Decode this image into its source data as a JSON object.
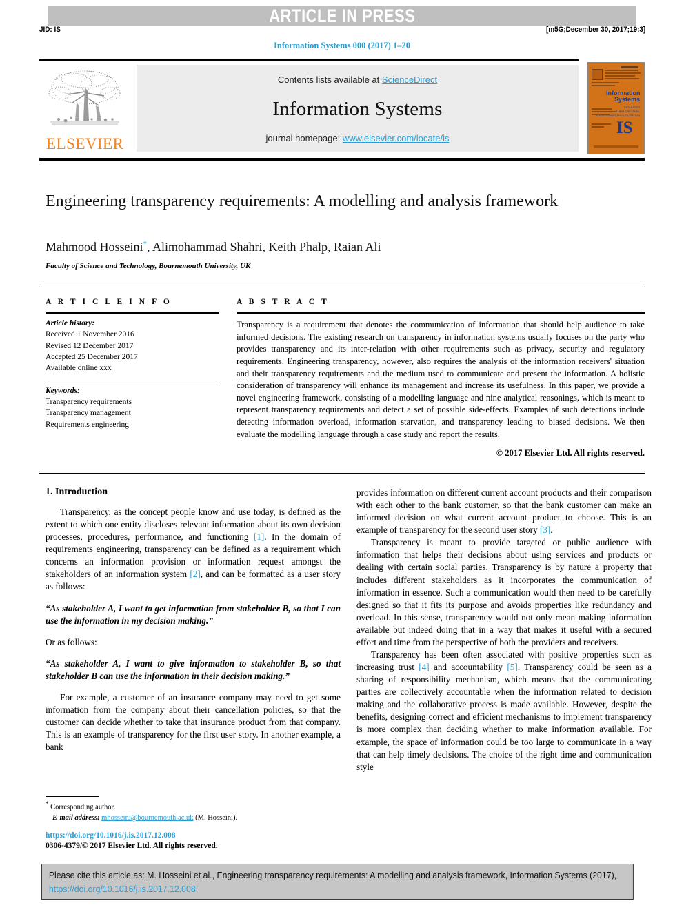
{
  "header": {
    "banner_text": "ARTICLE IN PRESS",
    "jid": "JID: IS",
    "stamp": "[m5G;December 30, 2017;19:3]",
    "journal_ref": "Information Systems 000 (2017) 1–20"
  },
  "masthead": {
    "contents_prefix": "Contents lists available at ",
    "sciencedirect_link": "ScienceDirect",
    "journal_name": "Information Systems",
    "homepage_prefix": "journal homepage: ",
    "homepage_link": "www.elsevier.com/locate/is",
    "publisher_logo_text": "ELSEVIER",
    "cover": {
      "title_line1": "Information",
      "title_line2": "Systems",
      "subtitle": "DATABASES",
      "subtitle2": "THEIR CREATION, MANAGEMENT AND UTILIZATION",
      "logo_text": "IS"
    }
  },
  "article": {
    "title": "Engineering transparency requirements: A modelling and analysis framework",
    "authors": "Mahmood Hosseini, Alimohammad Shahri, Keith Phalp, Raian Ali",
    "corresponding_marker": "*",
    "affiliation": "Faculty of Science and Technology, Bournemouth University, UK"
  },
  "article_info": {
    "heading": "A R T I C L E   I N F O",
    "history_label": "Article history:",
    "history": [
      "Received 1 November 2016",
      "Revised 12 December 2017",
      "Accepted 25 December 2017",
      "Available online xxx"
    ],
    "keywords_label": "Keywords:",
    "keywords": [
      "Transparency requirements",
      "Transparency management",
      "Requirements engineering"
    ]
  },
  "abstract": {
    "heading": "A B S T R A C T",
    "body": "Transparency is a requirement that denotes the communication of information that should help audience to take informed decisions. The existing research on transparency in information systems usually focuses on the party who provides transparency and its inter-relation with other requirements such as privacy, security and regulatory requirements. Engineering transparency, however, also requires the analysis of the information receivers' situation and their transparency requirements and the medium used to communicate and present the information. A holistic consideration of transparency will enhance its management and increase its usefulness. In this paper, we provide a novel engineering framework, consisting of a modelling language and nine analytical reasonings, which is meant to represent transparency requirements and detect a set of possible side-effects. Examples of such detections include detecting information overload, information starvation, and transparency leading to biased decisions. We then evaluate the modelling language through a case study and report the results.",
    "copyright": "© 2017 Elsevier Ltd. All rights reserved."
  },
  "body": {
    "section_heading": "1. Introduction",
    "left": {
      "p1_a": "Transparency, as the concept people know and use today, is defined as the extent to which one entity discloses relevant information about its own decision processes, procedures, performance, and functioning ",
      "p1_ref1": "[1]",
      "p1_b": ". In the domain of requirements engineering, transparency can be defined as a requirement which concerns an information provision or information request amongst the stakeholders of an information system ",
      "p1_ref2": "[2]",
      "p1_c": ", and can be formatted as a user story as follows:",
      "quote1": "“As stakeholder A, I want to get information from stakeholder B, so that I can use the information in my decision making.”",
      "or_line": "Or as follows:",
      "quote2": "“As stakeholder A, I want to give information to stakeholder B, so that stakeholder B can use the information in their decision making.”",
      "p2": "For example, a customer of an insurance company may need to get some information from the company about their cancellation policies, so that the customer can decide whether to take that insurance product from that company. This is an example of transparency for the first user story. In another example, a bank"
    },
    "right": {
      "p1_a": "provides information on different current account products and their comparison with each other to the bank customer, so that the bank customer can make an informed decision on what current account product to choose. This is an example of transparency for the second user story ",
      "p1_ref3": "[3]",
      "p1_b": ".",
      "p2": "Transparency is meant to provide targeted or public audience with information that helps their decisions about using services and products or dealing with certain social parties. Transparency is by nature a property that includes different stakeholders as it incorporates the communication of information in essence. Such a communication would then need to be carefully designed so that it fits its purpose and avoids properties like redundancy and overload. In this sense, transparency would not only mean making information available but indeed doing that in a way that makes it useful with a secured effort and time from the perspective of both the providers and receivers.",
      "p3_a": "Transparency has been often associated with positive properties such as increasing trust ",
      "p3_ref4": "[4]",
      "p3_b": " and accountability ",
      "p3_ref5": "[5]",
      "p3_c": ". Transparency could be seen as a sharing of responsibility mechanism, which means that the communicating parties are collectively accountable when the information related to decision making and the collaborative process is made available. However, despite the benefits, designing correct and efficient mechanisms to implement transparency is more complex than deciding whether to make information available. For example, the space of information could be too large to communicate in a way that can help timely decisions. The choice of the right time and communication style"
    }
  },
  "footnote": {
    "corresponding": "Corresponding author.",
    "email_label": "E-mail address:",
    "email": "mhosseini@bournemouth.ac.uk",
    "email_suffix": "(M. Hosseini).",
    "doi": "https://doi.org/10.1016/j.is.2017.12.008",
    "issn_copyright": "0306-4379/© 2017 Elsevier Ltd. All rights reserved."
  },
  "cite_box": {
    "text_a": "Please cite this article as: M. Hosseini et al., Engineering transparency requirements: A modelling and analysis framework, Information Systems (2017), ",
    "link": "https://doi.org/10.1016/j.is.2017.12.008"
  },
  "colors": {
    "link_blue": "#2a9fd6",
    "elsevier_orange": "#f5831f",
    "banner_grey": "#bfbfbf",
    "mast_grey": "#ececec",
    "cite_grey": "#c6c6c6",
    "cover_orange": "#d2731a"
  }
}
